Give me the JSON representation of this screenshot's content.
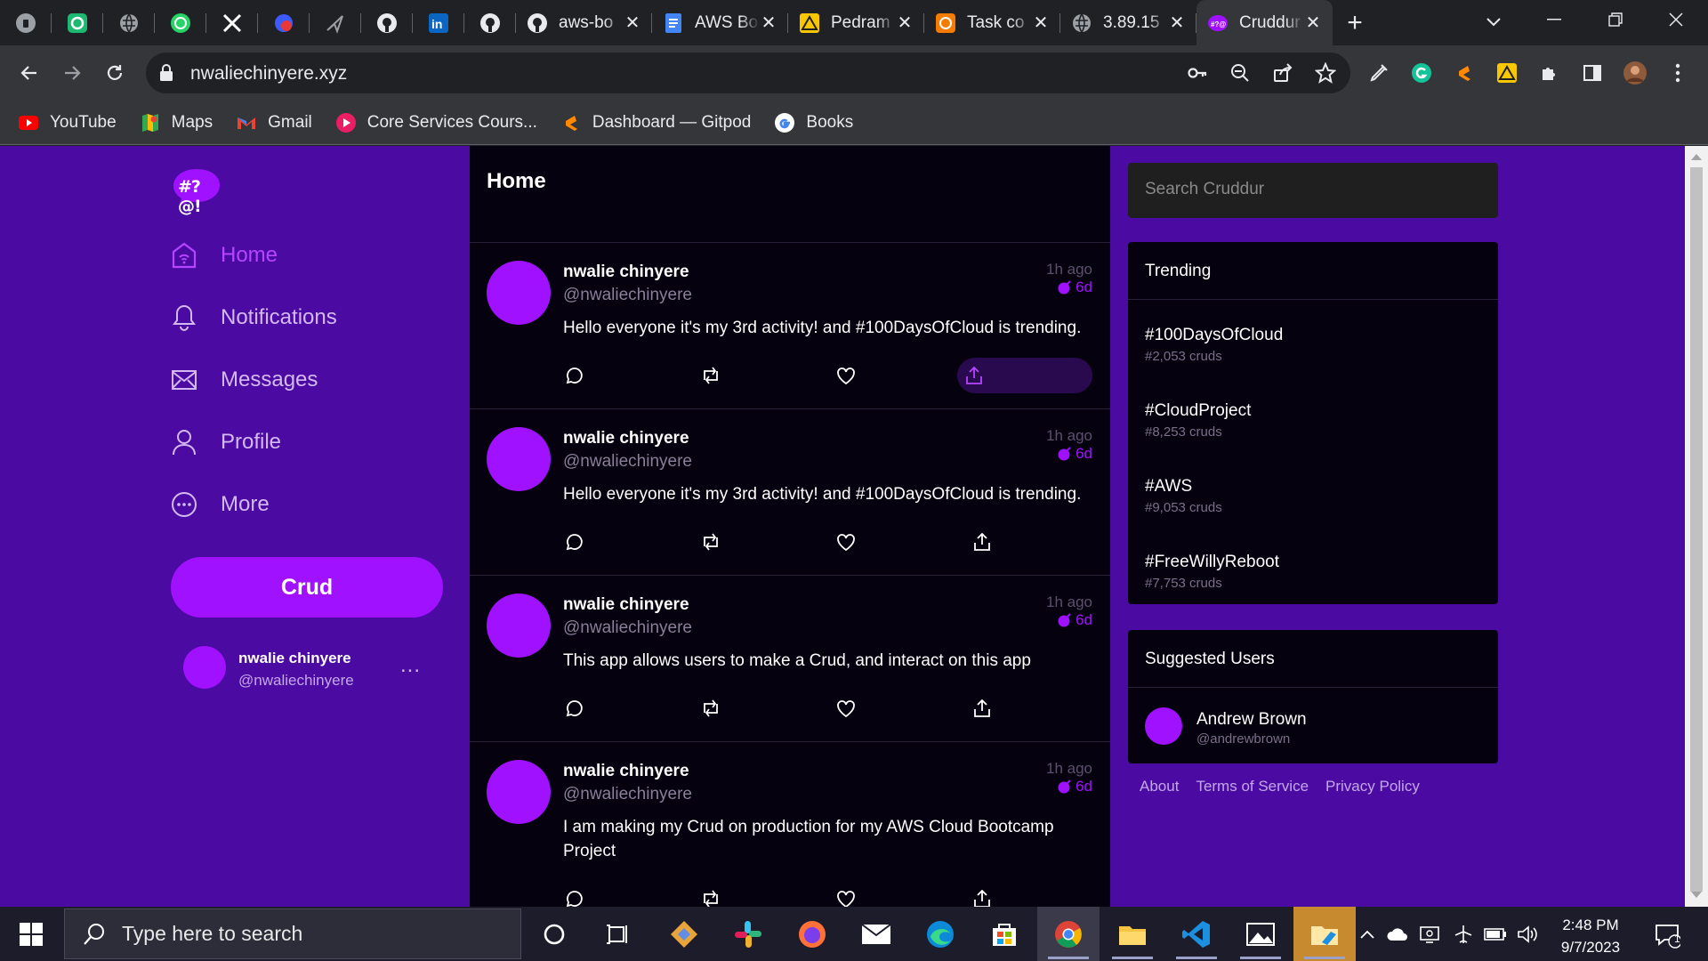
{
  "browser": {
    "tabs": [
      {
        "title": "aws-bo"
      },
      {
        "title": "AWS Bo"
      },
      {
        "title": "Pedram"
      },
      {
        "title": "Task co"
      },
      {
        "title": "3.89.15"
      },
      {
        "title": "Cruddur"
      }
    ],
    "new_tab": "+",
    "url": "nwaliechinyere.xyz",
    "bookmarks": [
      "YouTube",
      "Maps",
      "Gmail",
      "Core Services Cours...",
      "Dashboard — Gitpod",
      "Books"
    ]
  },
  "app": {
    "logo_text": "#?@!",
    "nav": [
      {
        "label": "Home",
        "icon": "home-icon",
        "active": true
      },
      {
        "label": "Notifications",
        "icon": "bell-icon"
      },
      {
        "label": "Messages",
        "icon": "envelope-icon"
      },
      {
        "label": "Profile",
        "icon": "person-icon"
      },
      {
        "label": "More",
        "icon": "more-circle-icon"
      }
    ],
    "crud_button": "Crud",
    "current_user": {
      "name": "nwalie chinyere",
      "handle": "@nwaliechinyere",
      "more": "..."
    },
    "feed_title": "Home",
    "posts": [
      {
        "name": "nwalie chinyere",
        "handle": "@nwaliechinyere",
        "ago": "1h ago",
        "expires": "6d",
        "message": "Hello everyone it's my 3rd activity! and #100DaysOfCloud is trending."
      },
      {
        "name": "nwalie chinyere",
        "handle": "@nwaliechinyere",
        "ago": "1h ago",
        "expires": "6d",
        "message": "Hello everyone it's my 3rd activity! and #100DaysOfCloud is trending."
      },
      {
        "name": "nwalie chinyere",
        "handle": "@nwaliechinyere",
        "ago": "1h ago",
        "expires": "6d",
        "message": "This app allows users to make a Crud, and interact on this app"
      },
      {
        "name": "nwalie chinyere",
        "handle": "@nwaliechinyere",
        "ago": "1h ago",
        "expires": "6d",
        "message": "I am making my Crud on production for my AWS Cloud Bootcamp Project"
      }
    ],
    "search_placeholder": "Search Cruddur",
    "trending": {
      "title": "Trending",
      "items": [
        {
          "tag": "#100DaysOfCloud",
          "count": "#2,053 cruds"
        },
        {
          "tag": "#CloudProject",
          "count": "#8,253 cruds"
        },
        {
          "tag": "#AWS",
          "count": "#9,053 cruds"
        },
        {
          "tag": "#FreeWillyReboot",
          "count": "#7,753 cruds"
        }
      ]
    },
    "suggested": {
      "title": "Suggested Users",
      "users": [
        {
          "name": "Andrew Brown",
          "handle": "@andrewbrown"
        }
      ]
    },
    "footer_links": [
      "About",
      "Terms of Service",
      "Privacy Policy"
    ]
  },
  "taskbar": {
    "search_placeholder": "Type here to search",
    "time": "2:48 PM",
    "date": "9/7/2023",
    "notification_count": "1"
  },
  "colors": {
    "brand": "#9f11ff",
    "page_bg": "#4b0ba2",
    "feed_bg": "#05010f"
  }
}
